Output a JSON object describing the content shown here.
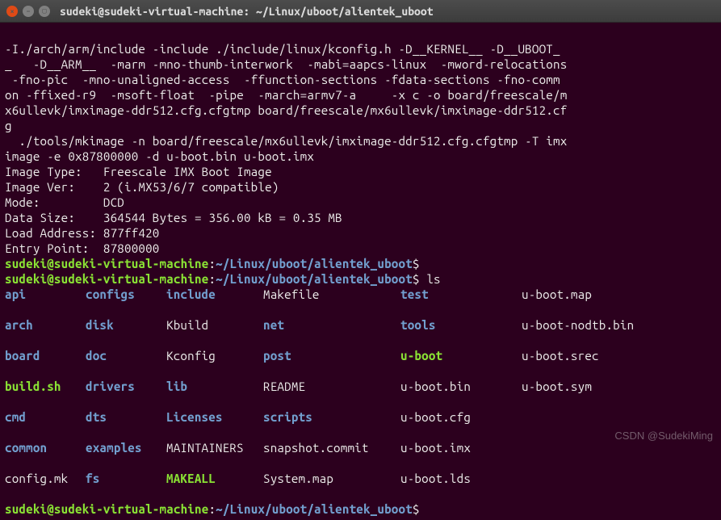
{
  "window": {
    "title": "sudeki@sudeki-virtual-machine: ~/Linux/uboot/alientek_uboot"
  },
  "output": {
    "line1": "-I./arch/arm/include -include ./include/linux/kconfig.h -D__KERNEL__ -D__UBOOT_",
    "line2": "_   -D__ARM__  -marm -mno-thumb-interwork  -mabi=aapcs-linux  -mword-relocations",
    "line3": " -fno-pic  -mno-unaligned-access  -ffunction-sections -fdata-sections -fno-comm",
    "line4": "on -ffixed-r9  -msoft-float  -pipe  -march=armv7-a     -x c -o board/freescale/m",
    "line5": "x6ullevk/imximage-ddr512.cfg.cfgtmp board/freescale/mx6ullevk/imximage-ddr512.cf",
    "line6": "g",
    "line7": "  ./tools/mkimage -n board/freescale/mx6ullevk/imximage-ddr512.cfg.cfgtmp -T imx",
    "line8": "image -e 0x87800000 -d u-boot.bin u-boot.imx",
    "line9": "Image Type:   Freescale IMX Boot Image",
    "line10": "Image Ver:    2 (i.MX53/6/7 compatible)",
    "line11": "Mode:         DCD",
    "line12": "Data Size:    364544 Bytes = 356.00 kB = 0.35 MB",
    "line13": "Load Address: 877ff420",
    "line14": "Entry Point:  87800000"
  },
  "prompt": {
    "user": "sudeki@sudeki-virtual-machine",
    "sep": ":",
    "path": "~/Linux/uboot/alientek_uboot",
    "dollar": "$"
  },
  "cmd": {
    "ls": " ls"
  },
  "ls": {
    "r1c1": "api",
    "r1c2": "configs",
    "r1c3": "include",
    "r1c4": "Makefile",
    "r1c5": "test",
    "r1c6": "u-boot.map",
    "r2c1": "arch",
    "r2c2": "disk",
    "r2c3": "Kbuild",
    "r2c4": "net",
    "r2c5": "tools",
    "r2c6": "u-boot-nodtb.bin",
    "r3c1": "board",
    "r3c2": "doc",
    "r3c3": "Kconfig",
    "r3c4": "post",
    "r3c5": "u-boot",
    "r3c6": "u-boot.srec",
    "r4c1": "build.sh",
    "r4c2": "drivers",
    "r4c3": "lib",
    "r4c4": "README",
    "r4c5": "u-boot.bin",
    "r4c6": "u-boot.sym",
    "r5c1": "cmd",
    "r5c2": "dts",
    "r5c3": "Licenses",
    "r5c4": "scripts",
    "r5c5": "u-boot.cfg",
    "r5c6": "",
    "r6c1": "common",
    "r6c2": "examples",
    "r6c3": "MAINTAINERS",
    "r6c4": "snapshot.commit",
    "r6c5": "u-boot.imx",
    "r6c6": "",
    "r7c1": "config.mk",
    "r7c2": "fs",
    "r7c3": "MAKEALL",
    "r7c4": "System.map",
    "r7c5": "u-boot.lds",
    "r7c6": ""
  },
  "watermark": "CSDN @SudekiMing"
}
